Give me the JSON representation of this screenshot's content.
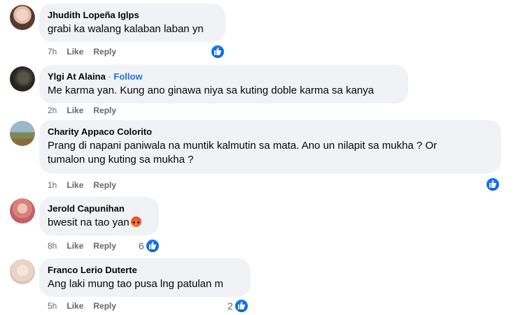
{
  "comments": [
    {
      "name": "Jhudith Lopeña Iglps",
      "text": "grabi ka walang kalaban laban yn",
      "time": "7h",
      "like_label": "Like",
      "reply_label": "Reply",
      "reaction_count": ""
    },
    {
      "name": "Ylgi At Alaina",
      "follow_separator": "·",
      "follow_label": "Follow",
      "text": "Me karma yan. Kung ano ginawa niya sa kuting doble karma sa kanya",
      "time": "2h",
      "like_label": "Like",
      "reply_label": "Reply"
    },
    {
      "name": "Charity Appaco Colorito",
      "text_line1": "Prang di napani paniwala na muntik kalmutin sa mata. Ano un nilapit sa mukha ? Or",
      "text_line2": "tumalon ung kuting sa mukha ?",
      "time": "1h",
      "like_label": "Like",
      "reply_label": "Reply"
    },
    {
      "name": "Jerold Capunihan",
      "text": "bwesit na tao yan",
      "time": "8h",
      "like_label": "Like",
      "reply_label": "Reply",
      "reaction_count": "6"
    },
    {
      "name": "Franco Lerio Duterte",
      "text": "Ang laki mung tao pusa lng patulan m",
      "time": "5h",
      "like_label": "Like",
      "reply_label": "Reply",
      "reaction_count": "2"
    }
  ],
  "icons": {
    "like_reaction": "thumbs-up-icon",
    "angry_emoji": "angry-face-icon"
  },
  "colors": {
    "bubble": "#f0f2f5",
    "meta_text": "#65676b",
    "follow": "#1b74e4",
    "like_blue": "#1877f2"
  }
}
